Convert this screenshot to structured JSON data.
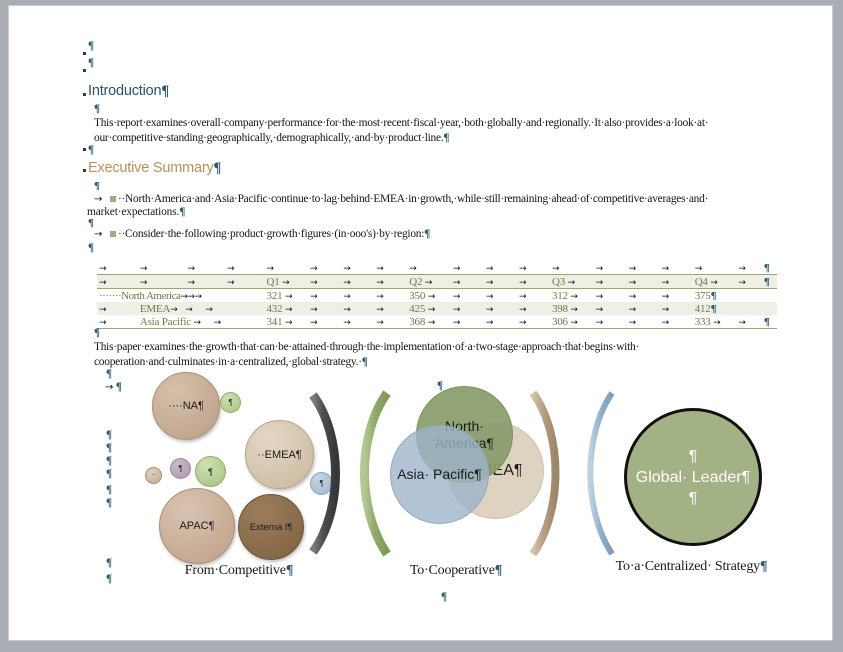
{
  "document": {
    "headings": {
      "introduction": "Introduction",
      "executive_summary": "Executive Summary"
    },
    "paragraphs": {
      "intro_line1": "This·report·examines·overall·company·performance·for·the·most·recent·fiscal·year,·both·globally·and·regionally.·It·also·provides·a·look·at·",
      "intro_line2": "our·competitive·standing·geographically,·demographically,·and·by·product·line.",
      "exec_bullet1_line1": "North·America·and·Asia·Pacific·continue·to·lag·behind·EMEA·in·growth,·while·still·remaining·ahead·of·competitive·averages·and·",
      "exec_bullet1_line2": "market·expectations.",
      "exec_bullet2": "Consider·the·following·product·growth·figures·(in·ooo's)·by·region:",
      "closing_line1": "This·paper·examines·the·growth·that·can·be·attained·through·the·implementation·of·a·two-stage·approach·that·begins·with·",
      "closing_line2": "cooperation·and·culminates·in·a·centralized,·global·strategy.·"
    },
    "marks": {
      "pilcrow": "¶",
      "tab_arrow": "→",
      "dot_leader": "·"
    }
  },
  "table": {
    "columns": [
      "",
      "Q1",
      "Q2",
      "Q3",
      "Q4"
    ],
    "rows": [
      {
        "label": "North America",
        "values": [
          "321",
          "350",
          "312",
          "375"
        ]
      },
      {
        "label": "EMEA",
        "values": [
          "432",
          "425",
          "398",
          "412"
        ]
      },
      {
        "label": "Asia Pacific",
        "values": [
          "341",
          "368",
          "306",
          "333"
        ]
      }
    ]
  },
  "diagrams": [
    {
      "caption": "From·Competitive",
      "name": "from-competitive",
      "bubbles": [
        {
          "label": "NA",
          "prefix": "····",
          "color": "#c3a78f"
        },
        {
          "label": "EMEA",
          "prefix": "··",
          "color": "#d3c4ac"
        },
        {
          "label": "APAC",
          "prefix": "",
          "color": "#c3a78f"
        },
        {
          "label": "Externa l",
          "prefix": "",
          "color": "#8e6f50"
        }
      ],
      "accent_circles": [
        "#b6cb95",
        "#b8a3ba",
        "#b6cb95",
        "#c6ae93",
        "#9db6cd"
      ],
      "arc_color": "#54565a"
    },
    {
      "caption": "To·Cooperative",
      "name": "to-cooperative",
      "bubbles": [
        {
          "label": "North· America",
          "color": "#8a9c6c"
        },
        {
          "label": "Asia· Pacific",
          "color": "#9eb4cb"
        },
        {
          "label": "EMEA",
          "color": "#ddd3c0"
        }
      ],
      "arc_left_color": "#93ad6e",
      "arc_right_color": "#b8a489"
    },
    {
      "caption": "To·a·Centralized· Strategy",
      "name": "to-centralized-strategy",
      "bubbles": [
        {
          "label": "Global· Leader",
          "color": "#a3b284"
        }
      ],
      "arc_color": "#8fadc6"
    }
  ],
  "colors": {
    "page_background": "#a9adb3",
    "page": "#ffffff",
    "heading_intro": "#2d5165",
    "heading_exec": "#b5915e",
    "table_border": "#9aa86f",
    "table_band": "#eef0e6",
    "table_text": "#7e8a52",
    "pilcrow": "#2e5a6e",
    "square_bullet": "#9bb07a"
  }
}
